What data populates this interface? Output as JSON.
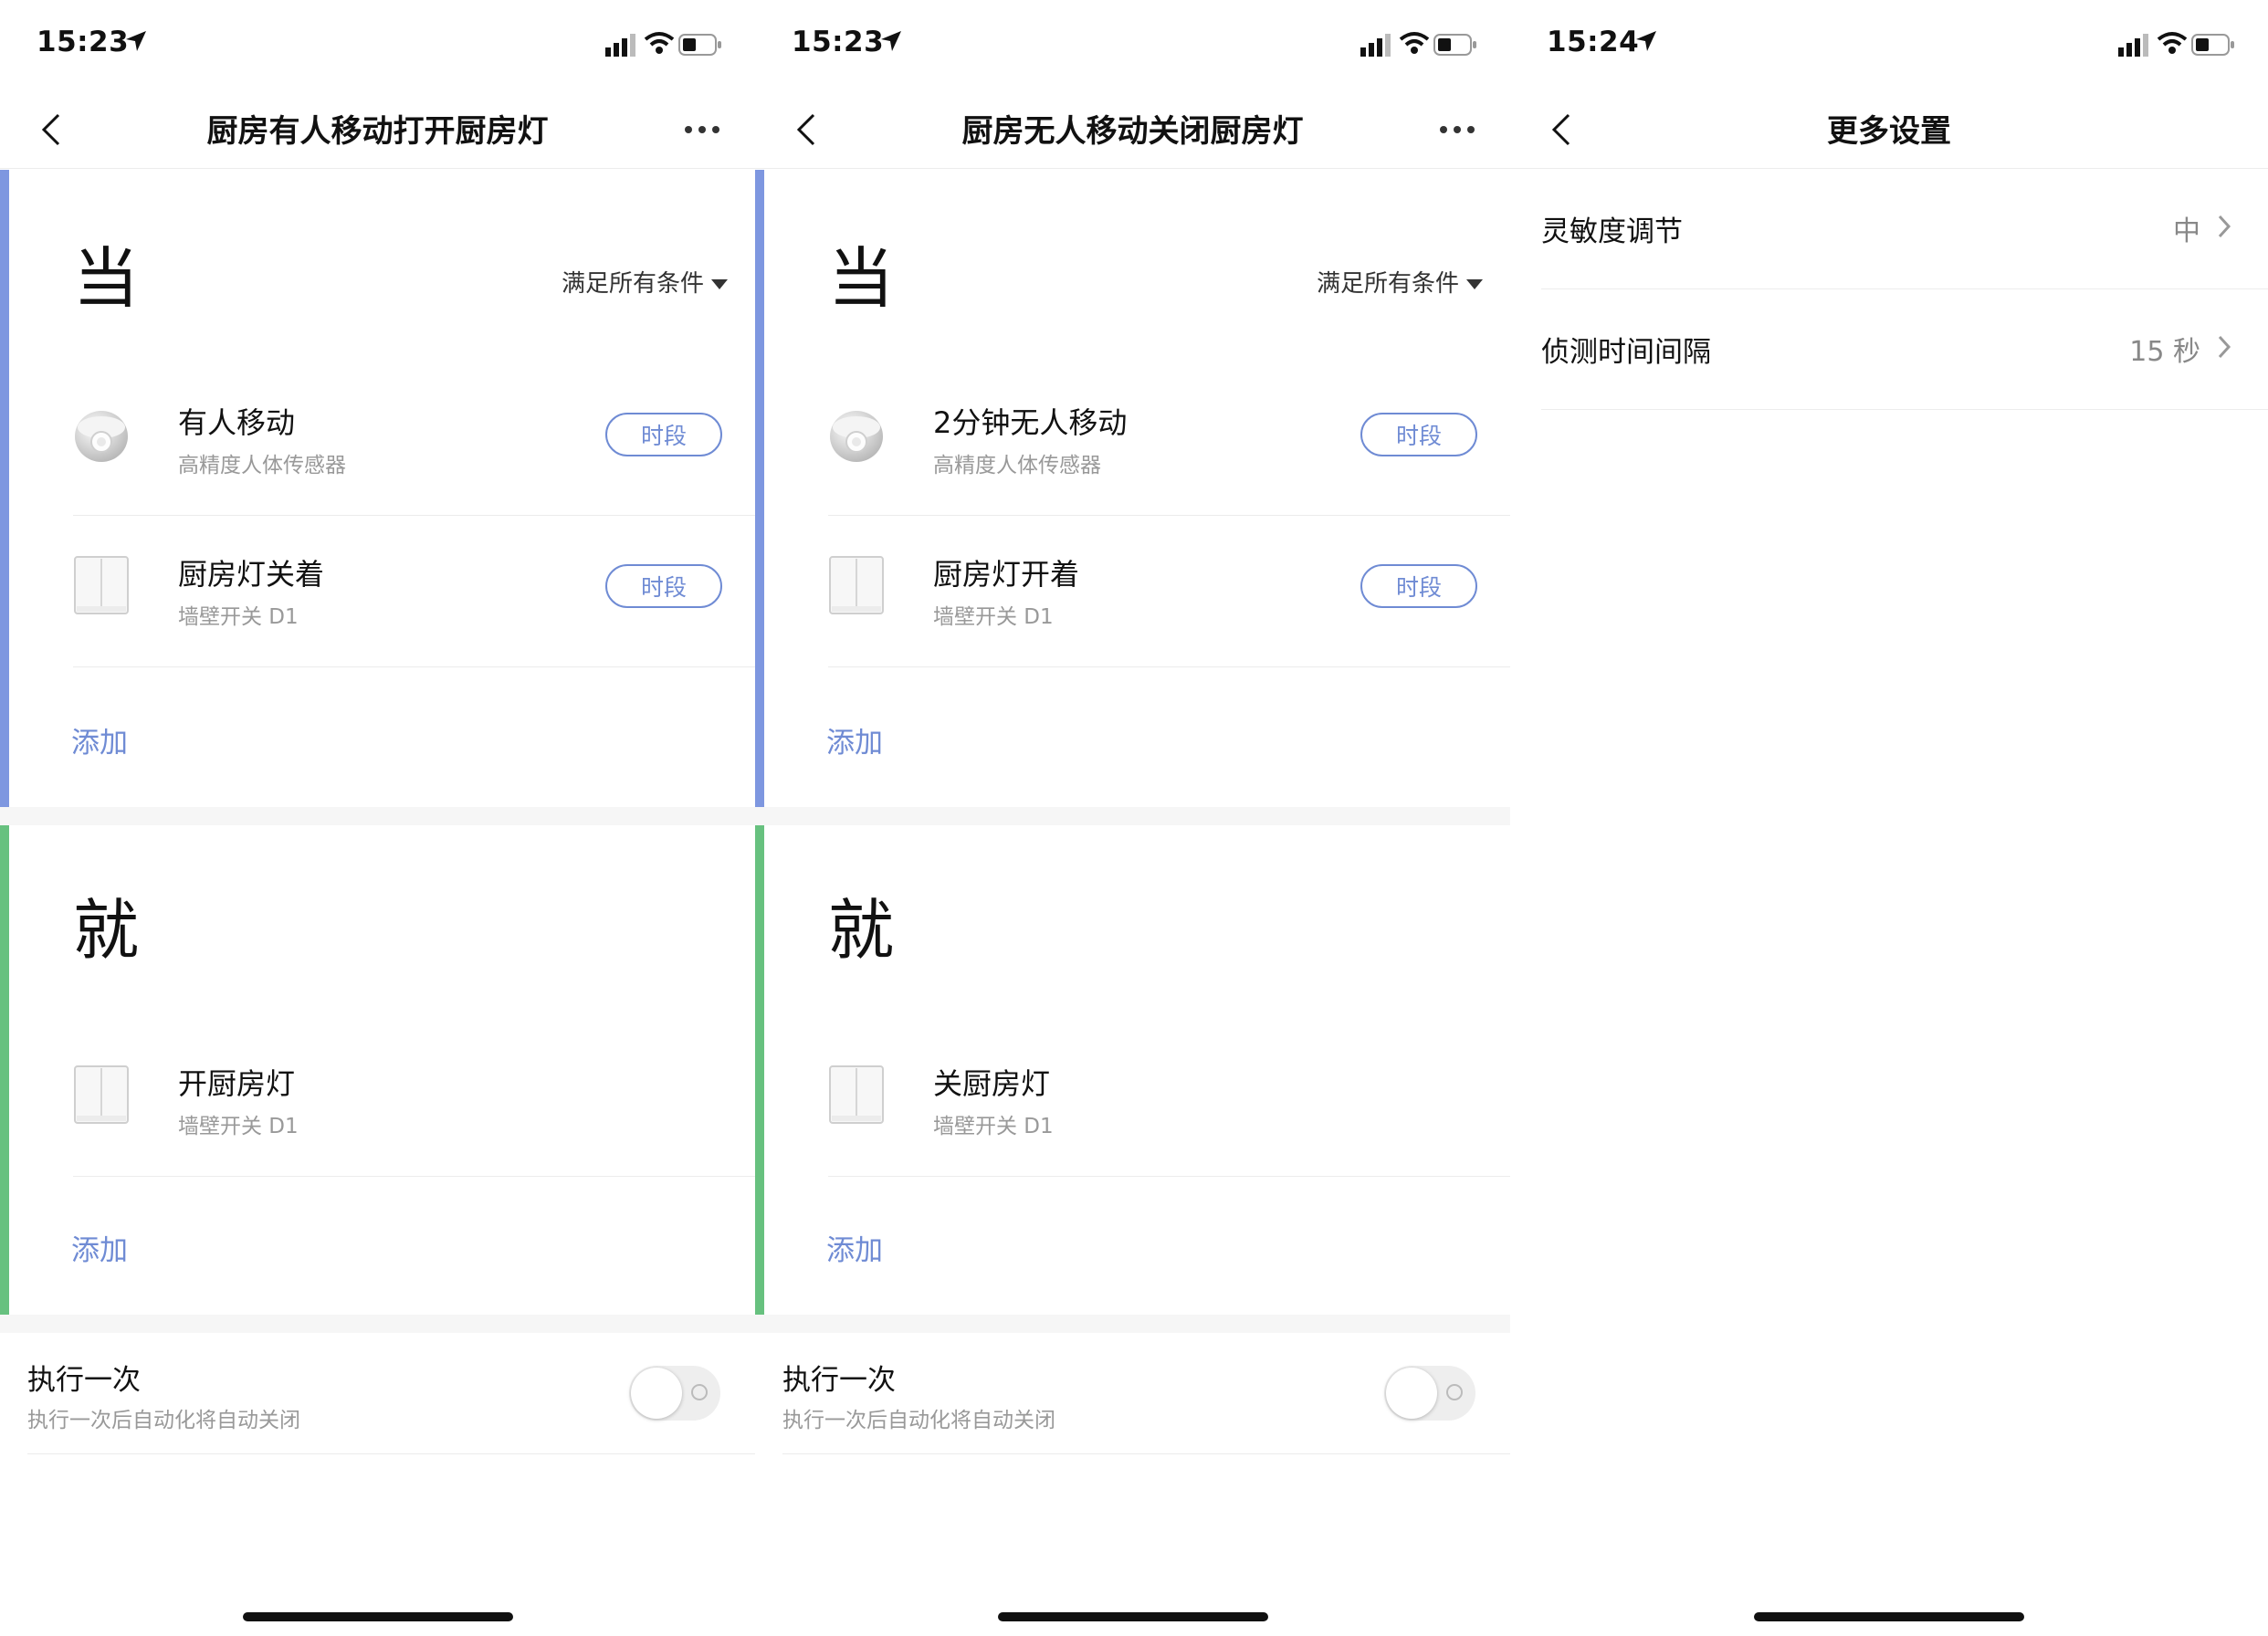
{
  "screens": [
    {
      "status": {
        "time": "15:23"
      },
      "nav": {
        "title": "厨房有人移动打开厨房灯"
      },
      "when": {
        "heading": "当",
        "condition_mode": "满足所有条件",
        "items": [
          {
            "title": "有人移动",
            "subtitle": "高精度人体传感器",
            "tag": "时段"
          },
          {
            "title": "厨房灯关着",
            "subtitle": "墙壁开关 D1",
            "tag": "时段"
          }
        ],
        "add_label": "添加"
      },
      "then": {
        "heading": "就",
        "items": [
          {
            "title": "开厨房灯",
            "subtitle": "墙壁开关 D1"
          }
        ],
        "add_label": "添加"
      },
      "once": {
        "title": "执行一次",
        "subtitle": "执行一次后自动化将自动关闭",
        "enabled": false
      }
    },
    {
      "status": {
        "time": "15:23"
      },
      "nav": {
        "title": "厨房无人移动关闭厨房灯"
      },
      "when": {
        "heading": "当",
        "condition_mode": "满足所有条件",
        "items": [
          {
            "title": "2分钟无人移动",
            "subtitle": "高精度人体传感器",
            "tag": "时段"
          },
          {
            "title": "厨房灯开着",
            "subtitle": "墙壁开关 D1",
            "tag": "时段"
          }
        ],
        "add_label": "添加"
      },
      "then": {
        "heading": "就",
        "items": [
          {
            "title": "关厨房灯",
            "subtitle": "墙壁开关 D1"
          }
        ],
        "add_label": "添加"
      },
      "once": {
        "title": "执行一次",
        "subtitle": "执行一次后自动化将自动关闭",
        "enabled": false
      }
    },
    {
      "status": {
        "time": "15:24"
      },
      "nav": {
        "title": "更多设置"
      },
      "settings": [
        {
          "label": "灵敏度调节",
          "value": "中"
        },
        {
          "label": "侦测时间间隔",
          "value": "15 秒"
        }
      ]
    }
  ],
  "colors": {
    "when_accent": "#7e97e0",
    "then_accent": "#67c17f",
    "link": "#6f8bd4"
  },
  "icons": [
    "location-arrow-icon",
    "signal-icon",
    "wifi-icon",
    "battery-icon",
    "back-chevron-icon",
    "more-dots-icon",
    "motion-sensor-icon",
    "wall-switch-icon",
    "toggle-switch",
    "chevron-right-icon"
  ]
}
